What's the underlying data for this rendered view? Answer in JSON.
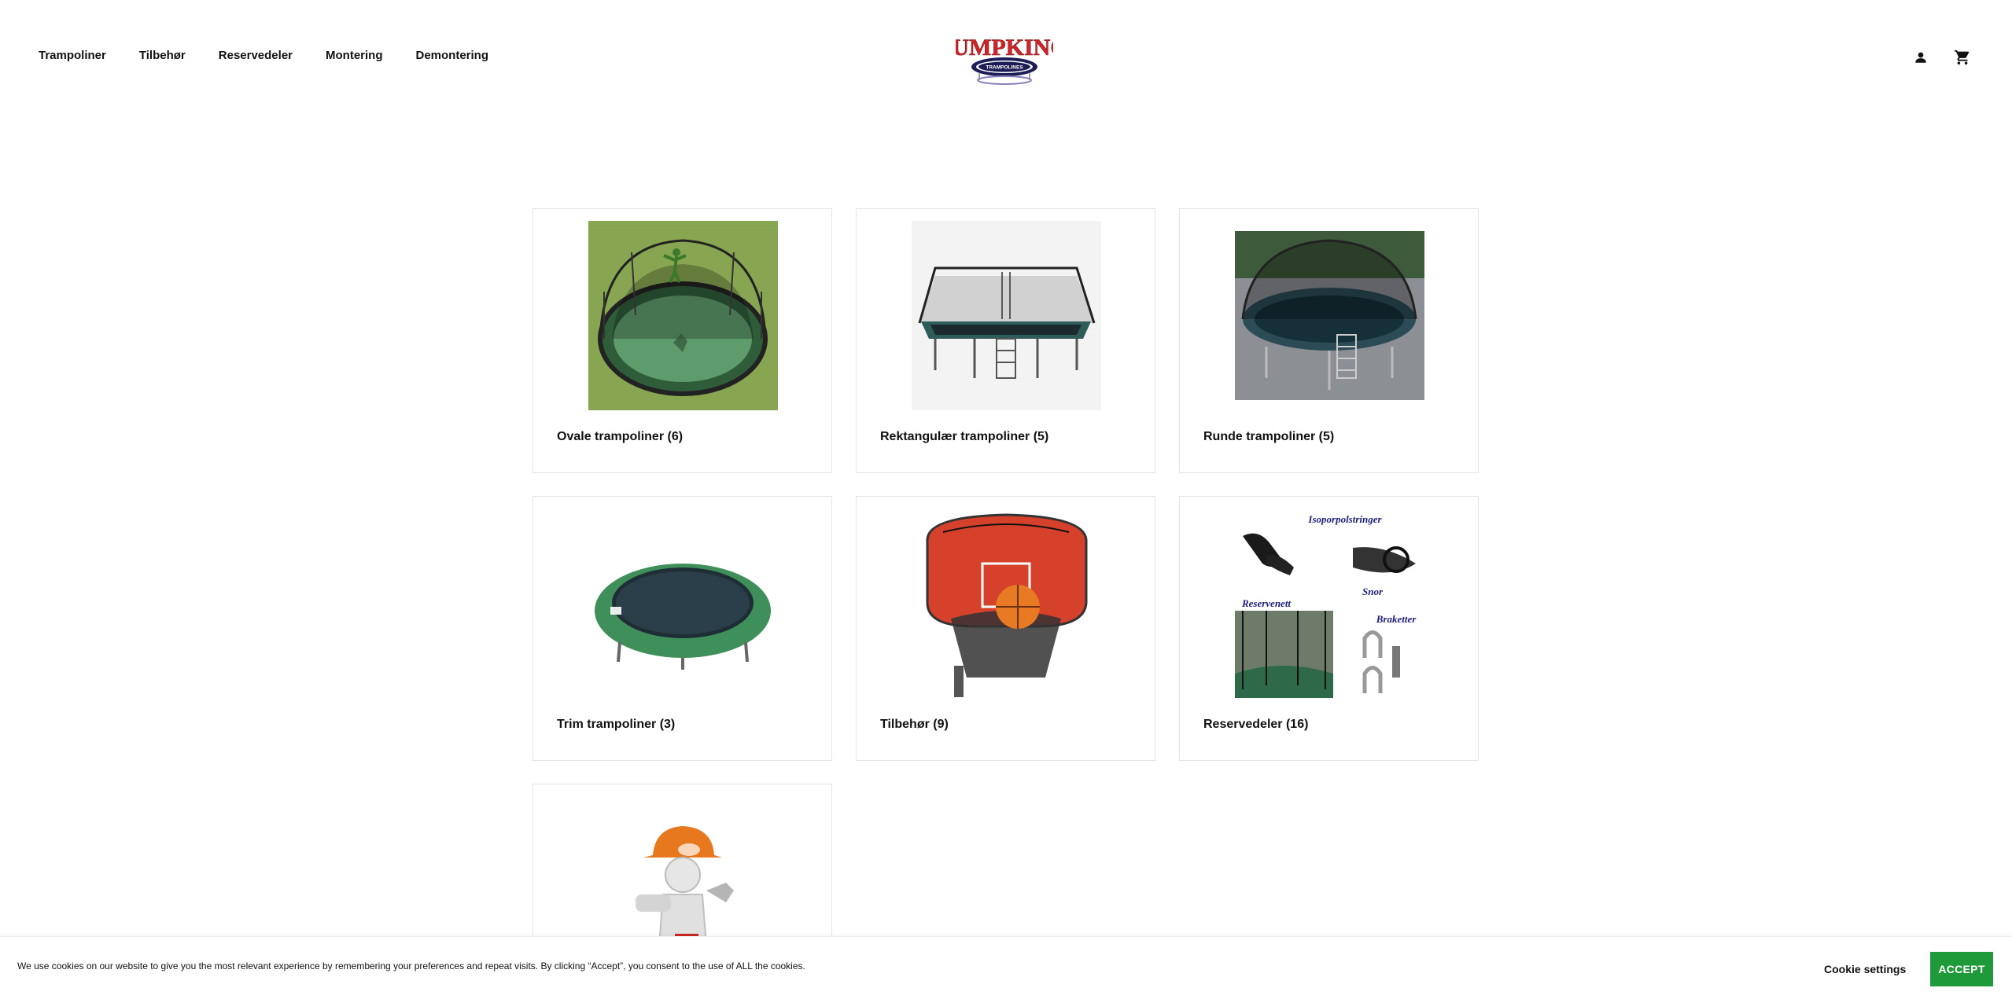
{
  "nav": {
    "items": [
      {
        "label": "Trampoliner"
      },
      {
        "label": "Tilbehør"
      },
      {
        "label": "Reservedeler"
      },
      {
        "label": "Montering"
      },
      {
        "label": "Demontering"
      }
    ]
  },
  "logo": {
    "line1": "JUMPKING",
    "line2": "TRAMPOLINES"
  },
  "header": {
    "account_icon": "person-icon",
    "cart_icon": "shopping-cart-icon"
  },
  "categories": [
    {
      "title": "Ovale trampoliner (6)",
      "image": "oval-trampoline-image"
    },
    {
      "title": "Rektangulær trampoliner (5)",
      "image": "rectangular-trampoline-image"
    },
    {
      "title": "Runde trampoliner (5)",
      "image": "round-trampoline-image"
    },
    {
      "title": "Trim trampoliner (3)",
      "image": "trim-trampoline-image"
    },
    {
      "title": "Tilbehør (9)",
      "image": "basketball-hoop-image"
    },
    {
      "title": "Reservedeler (16)",
      "image": "spare-parts-image"
    },
    {
      "title": "",
      "image": "assembly-worker-image"
    }
  ],
  "spare_parts_image_labels": {
    "a": "Isoporpolstringer",
    "b": "Snor",
    "c": "Reservenett",
    "d": "Braketter"
  },
  "cookie": {
    "text": "We use cookies on our website to give you the most relevant experience by remembering your preferences and repeat visits. By clicking “Accept”, you consent to the use of ALL the cookies.",
    "settings_label": "Cookie settings",
    "accept_label": "ACCEPT"
  },
  "colors": {
    "accept_green": "#1f9a3a",
    "logo_red": "#d0262b",
    "logo_navy": "#1c1e55"
  }
}
